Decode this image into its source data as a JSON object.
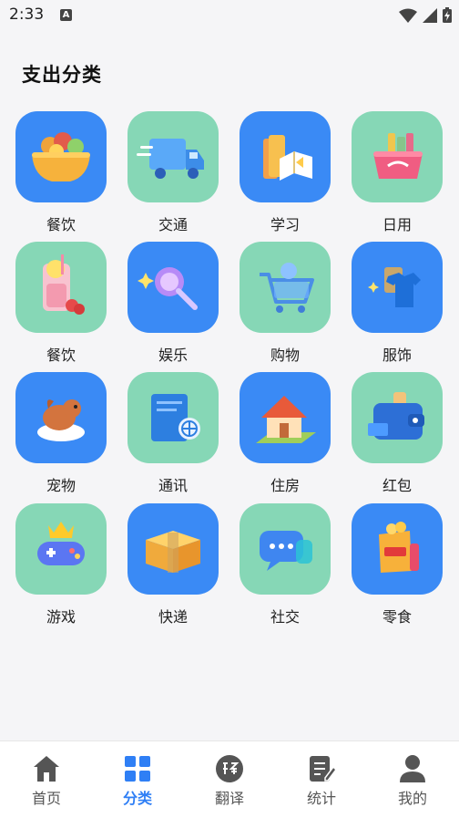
{
  "status": {
    "time": "2:33",
    "notification_glyph": "A"
  },
  "page": {
    "title": "支出分类"
  },
  "categories": [
    {
      "label": "餐饮",
      "icon": "food-bowl-icon",
      "tile_color": "#3a8af5"
    },
    {
      "label": "交通",
      "icon": "truck-icon",
      "tile_color": "#86d7b6"
    },
    {
      "label": "学习",
      "icon": "books-icon",
      "tile_color": "#3a8af5"
    },
    {
      "label": "日用",
      "icon": "gift-basket-icon",
      "tile_color": "#86d7b6"
    },
    {
      "label": "餐饮",
      "icon": "drink-icon",
      "tile_color": "#86d7b6"
    },
    {
      "label": "娱乐",
      "icon": "lollipop-icon",
      "tile_color": "#3a8af5"
    },
    {
      "label": "购物",
      "icon": "shopping-cart-icon",
      "tile_color": "#86d7b6"
    },
    {
      "label": "服饰",
      "icon": "shirt-icon",
      "tile_color": "#3a8af5"
    },
    {
      "label": "宠物",
      "icon": "dog-icon",
      "tile_color": "#3a8af5"
    },
    {
      "label": "通讯",
      "icon": "globe-document-icon",
      "tile_color": "#86d7b6"
    },
    {
      "label": "住房",
      "icon": "house-icon",
      "tile_color": "#3a8af5"
    },
    {
      "label": "红包",
      "icon": "wallet-icon",
      "tile_color": "#86d7b6"
    },
    {
      "label": "游戏",
      "icon": "gamepad-icon",
      "tile_color": "#86d7b6"
    },
    {
      "label": "快递",
      "icon": "package-icon",
      "tile_color": "#3a8af5"
    },
    {
      "label": "社交",
      "icon": "chat-bubble-icon",
      "tile_color": "#86d7b6"
    },
    {
      "label": "零食",
      "icon": "chips-icon",
      "tile_color": "#3a8af5"
    }
  ],
  "bottom_nav": [
    {
      "label": "首页",
      "icon": "home-icon",
      "active": false
    },
    {
      "label": "分类",
      "icon": "grid-icon",
      "active": true
    },
    {
      "label": "翻译",
      "icon": "translate-icon",
      "active": false
    },
    {
      "label": "统计",
      "icon": "edit-doc-icon",
      "active": false
    },
    {
      "label": "我的",
      "icon": "person-icon",
      "active": false
    }
  ],
  "colors": {
    "accent": "#2f7ff5",
    "tile_blue": "#3a8af5",
    "tile_green": "#86d7b6",
    "nav_inactive": "#555555"
  }
}
